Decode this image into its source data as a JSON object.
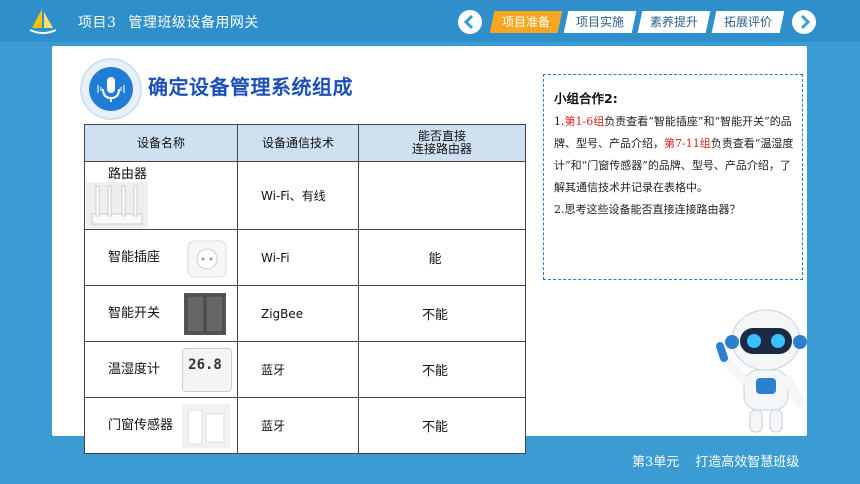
{
  "header": {
    "project_no": "项目3",
    "project_name": "管理班级设备用网关",
    "tabs": [
      {
        "label": "项目准备",
        "active": true
      },
      {
        "label": "项目实施",
        "active": false
      },
      {
        "label": "素养提升",
        "active": false
      },
      {
        "label": "拓展评价",
        "active": false
      }
    ]
  },
  "section": {
    "title": "确定设备管理系统组成"
  },
  "table": {
    "headers": [
      "设备名称",
      "设备通信技术",
      "能否直接",
      "连接路由器"
    ],
    "rows": [
      {
        "name": "路由器",
        "icon": "router",
        "tech": "Wi-Fi、有线",
        "connect": ""
      },
      {
        "name": "智能插座",
        "icon": "smart-plug",
        "tech": "Wi-Fi",
        "connect": "能"
      },
      {
        "name": "智能开关",
        "icon": "smart-switch",
        "tech": "ZigBee",
        "connect": "不能"
      },
      {
        "name": "温湿度计",
        "icon": "thermo-hygrometer",
        "tech": "蓝牙",
        "connect": "不能",
        "display": "26.8"
      },
      {
        "name": "门窗传感器",
        "icon": "door-sensor",
        "tech": "蓝牙",
        "connect": "不能"
      }
    ]
  },
  "note": {
    "title": "小组合作2:",
    "p1_prefix": "1.",
    "p1_group1": "第1-6组",
    "p1_text1": "负责查看“智能插座”和“智能开关”的品牌、型号、产品介绍，",
    "p1_group2": "第7-11组",
    "p1_text2": "负责查看“温湿度计”和“门窗传感器”的品牌、型号、产品介绍，了解其通信技术并记录在表格中。",
    "p2": "2.思考这些设备能否直接连接路由器？"
  },
  "footer": {
    "unit": "第3单元",
    "title": "打造高效智慧班级"
  },
  "colors": {
    "accent": "#f5a623",
    "background": "#3b9bd3",
    "title": "#1c4fb8",
    "highlight": "#e02020"
  }
}
